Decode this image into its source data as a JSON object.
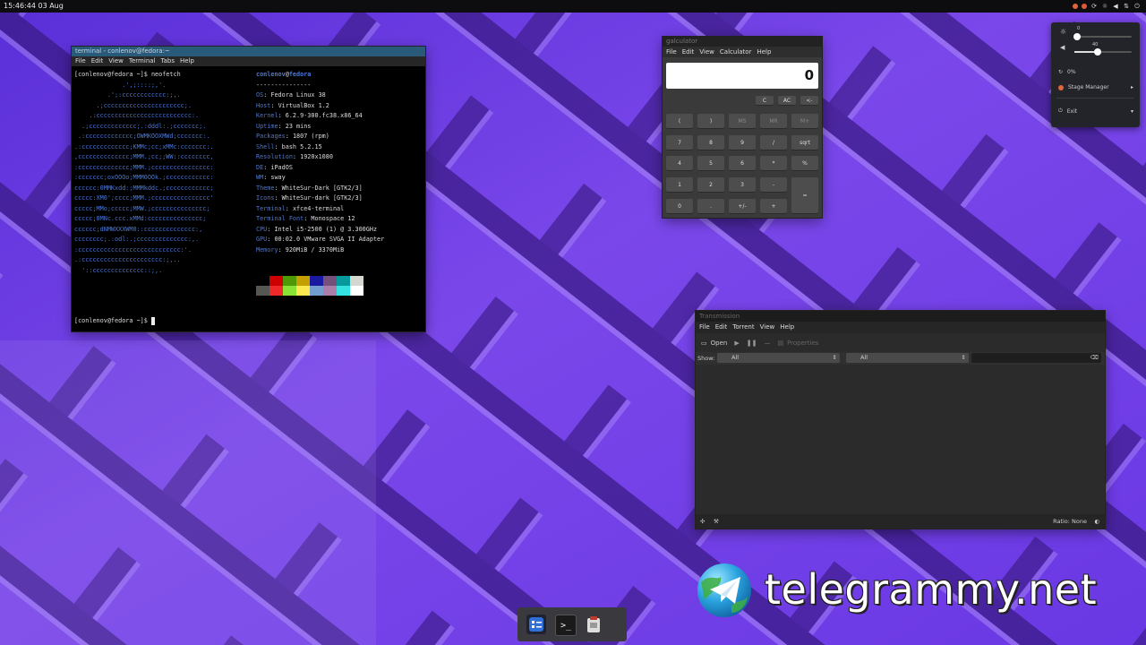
{
  "topbar": {
    "clock": "15:46:44 03 Aug",
    "tray_dot_colors": [
      "#e0653a",
      "#e05a3a"
    ]
  },
  "terminal": {
    "title": "terminal - conlenov@fedora:~",
    "menu": [
      "File",
      "Edit",
      "View",
      "Terminal",
      "Tabs",
      "Help"
    ],
    "prompt": "[conlenov@fedora ~]$ ",
    "command": "neofetch",
    "ascii_art": [
      "             .',;::::;,'.",
      "         .';:cccccccccccc:;,.",
      "      .;cccccccccccccccccccccc;.",
      "    .:cccccccccccccccccccccccccc:.",
      "  .;ccccccccccccc;.:dddl:.;ccccccc;.",
      " .:ccccccccccccc;OWMKOOXMWd;ccccccc:.",
      ".:ccccccccccccc;KMMc;cc;xMMc:ccccccc:.",
      ",cccccccccccccc;MMM.;cc;;WW::cccccccc,",
      ":cccccccccccccc;MMM.;cccccccccccccccc:",
      ":ccccccc;oxOOOo;MMM0OOk.;cccccccccccc:",
      "cccccc:0MMKxdd:;MMMkddc.;cccccccccccc;",
      "ccccc:XM0';cccc;MMM.;cccccccccccccccc'",
      "ccccc;MMo;ccccc;MMW.;ccccccccccccccc;",
      "ccccc;0MNc.ccc.xMMd:ccccccccccccccc;",
      "cccccc;dNMWXXXWM0::cccccccccccccc:,",
      "cccccccc;.:odl:.;cccccccccccccc:,.",
      ":cccccccccccccccccccccccccccc:'.",
      ".:cccccccccccccccccccccc:;,..",
      "  '::cccccccccccccc::;,."
    ],
    "user": "conlenov",
    "host": "fedora",
    "separator": "---------------",
    "info": [
      {
        "key": "OS",
        "value": "Fedora Linux 38"
      },
      {
        "key": "Host",
        "value": "VirtualBox 1.2"
      },
      {
        "key": "Kernel",
        "value": "6.2.9-300.fc38.x86_64"
      },
      {
        "key": "Uptime",
        "value": "23 mins"
      },
      {
        "key": "Packages",
        "value": "1807 (rpm)"
      },
      {
        "key": "Shell",
        "value": "bash 5.2.15"
      },
      {
        "key": "Resolution",
        "value": "1920x1080"
      },
      {
        "key": "DE",
        "value": "iPadOS"
      },
      {
        "key": "WM",
        "value": "sway"
      },
      {
        "key": "Theme",
        "value": "WhiteSur-Dark [GTK2/3]"
      },
      {
        "key": "Icons",
        "value": "WhiteSur-dark [GTK2/3]"
      },
      {
        "key": "Terminal",
        "value": "xfce4-terminal"
      },
      {
        "key": "Terminal Font",
        "value": "Monospace 12"
      },
      {
        "key": "CPU",
        "value": "Intel i5-2500 (1) @ 3.300GHz"
      },
      {
        "key": "GPU",
        "value": "00:02.0 VMware SVGA II Adapter"
      },
      {
        "key": "Memory",
        "value": "920MiB / 3370MiB"
      }
    ],
    "palette_top": [
      "#000000",
      "#cc0000",
      "#4e9a06",
      "#c4a000",
      "#1a1aa0",
      "#75507b",
      "#06989a",
      "#d3d7cf"
    ],
    "palette_bottom": [
      "#555753",
      "#ef2929",
      "#8ae234",
      "#fce94f",
      "#729fcf",
      "#ad7fa8",
      "#34e2e2",
      "#ffffff"
    ]
  },
  "calculator": {
    "title": "galculator",
    "menu": [
      "File",
      "Edit",
      "View",
      "Calculator",
      "Help"
    ],
    "display": "0",
    "top_buttons": [
      "C",
      "AC",
      "<-"
    ],
    "rows": [
      [
        "(",
        ")",
        "MS",
        "MR",
        "M+"
      ],
      [
        "7",
        "8",
        "9",
        "/",
        "sqrt"
      ],
      [
        "4",
        "5",
        "6",
        "*",
        "%"
      ],
      [
        "1",
        "2",
        "3",
        "-",
        "="
      ],
      [
        "0",
        ".",
        "+/-",
        "+"
      ]
    ]
  },
  "transmission": {
    "title": "Transmission",
    "menu": [
      "File",
      "Edit",
      "Torrent",
      "View",
      "Help"
    ],
    "toolbar": {
      "open": "Open",
      "properties": "Properties"
    },
    "filter": {
      "show_label": "Show:",
      "select1": "All",
      "select2": "All"
    },
    "status": {
      "ratio": "Ratio: None"
    }
  },
  "quick_settings": {
    "brightness_value": "0",
    "volume_value": "40",
    "brightness_level": 0.05,
    "volume_level": 0.4,
    "battery": "0%",
    "stage_manager": "Stage Manager",
    "exit": "Exit"
  },
  "dock": {
    "items": [
      "tasks-app",
      "terminal-app",
      "clipboard-app"
    ]
  },
  "watermark": {
    "text": "telegrammy.net"
  }
}
